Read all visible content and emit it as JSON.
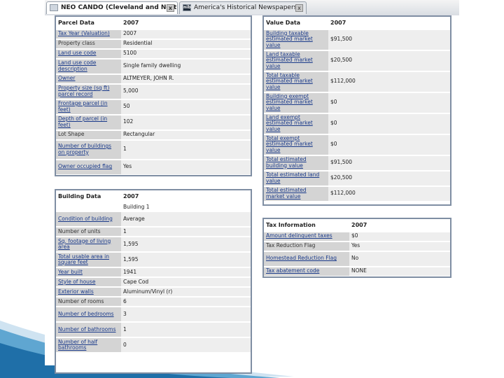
{
  "browser": {
    "tabs": [
      {
        "label": "NEO CANDO (Cleveland and Northe...",
        "active": true,
        "icon": "document-icon"
      },
      {
        "label": "America's Historical Newspapers",
        "active": false,
        "icon": "nib-logo-icon",
        "icon_text": "nib"
      }
    ],
    "close_glyph": "x"
  },
  "parcel": {
    "header": {
      "label": "Parcel Data",
      "year": "2007"
    },
    "rows": [
      {
        "label": "Tax Year (Valuation)",
        "value": "2007",
        "link": true
      },
      {
        "label": "Property class",
        "value": "Residential",
        "link": false
      },
      {
        "label": "Land use code",
        "value": "5100",
        "link": true
      },
      {
        "label": "Land use code description",
        "value": "Single family dwelling",
        "link": true
      },
      {
        "label": "Owner",
        "value": "ALTMEYER, JOHN R.",
        "link": true
      },
      {
        "label": "Property size (sq ft) parcel record",
        "value": "5,000",
        "link": true
      },
      {
        "label": "Frontage parcel (in feet)",
        "value": "50",
        "link": true
      },
      {
        "label": "Depth of parcel (in feet)",
        "value": "102",
        "link": true
      },
      {
        "label": "Lot Shape",
        "value": "Rectangular",
        "link": false
      },
      {
        "label": "Number of buildings on property",
        "value": "1",
        "link": true
      },
      {
        "label": "Owner occupied flag",
        "value": "Yes",
        "link": true
      }
    ]
  },
  "building": {
    "header": {
      "label": "Building Data",
      "year": "2007"
    },
    "subheader": "Building 1",
    "rows": [
      {
        "label": "Condition of building",
        "value": "Average",
        "link": true
      },
      {
        "label": "Number of units",
        "value": "1",
        "link": false
      },
      {
        "label": "Sq. footage of living area",
        "value": "1,595",
        "link": true
      },
      {
        "label": "Total usable area in square feet",
        "value": "1,595",
        "link": true
      },
      {
        "label": "Year built",
        "value": "1941",
        "link": true
      },
      {
        "label": "Style of house",
        "value": "Cape Cod",
        "link": true
      },
      {
        "label": "Exterior walls",
        "value": "Aluminum/Vinyl (r)",
        "link": true
      },
      {
        "label": "Number of rooms",
        "value": "6",
        "link": false
      },
      {
        "label": "Number of bedrooms",
        "value": "3",
        "link": true
      },
      {
        "label": "Number of bathrooms",
        "value": "1",
        "link": true
      },
      {
        "label": "Number of half bathrooms",
        "value": "0",
        "link": true
      }
    ]
  },
  "value": {
    "header": {
      "label": "Value Data",
      "year": "2007"
    },
    "rows": [
      {
        "label": "Building taxable estimated market value",
        "value": "$91,500",
        "link": true
      },
      {
        "label": "Land taxable estimated market value",
        "value": "$20,500",
        "link": true
      },
      {
        "label": "Total taxable estimated market value",
        "value": "$112,000",
        "link": true
      },
      {
        "label": "Building exempt estimated market value",
        "value": "$0",
        "link": true
      },
      {
        "label": "Land exempt estimated market value",
        "value": "$0",
        "link": true
      },
      {
        "label": "Total exempt estimated market value",
        "value": "$0",
        "link": true
      },
      {
        "label": "Total estimated building value",
        "value": "$91,500",
        "link": true
      },
      {
        "label": "Total estimated land value",
        "value": "$20,500",
        "link": true
      },
      {
        "label": "Total estimated market value",
        "value": "$112,000",
        "link": true
      }
    ]
  },
  "tax": {
    "header": {
      "label": "Tax Information",
      "year": "2007"
    },
    "rows": [
      {
        "label": "Amount delinquent taxes",
        "value": "$0",
        "link": true
      },
      {
        "label": "Tax Reduction Flag",
        "value": "Yes",
        "link": false
      },
      {
        "label": "Homestead Reduction Flag",
        "value": "No",
        "link": true
      },
      {
        "label": "Tax abatement code",
        "value": "NONE",
        "link": true
      }
    ]
  }
}
